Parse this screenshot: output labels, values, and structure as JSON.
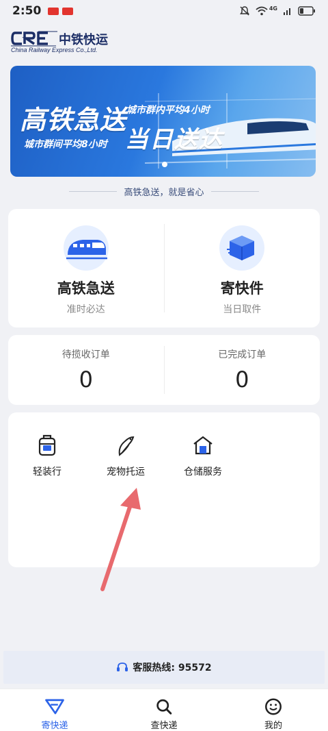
{
  "status_bar": {
    "time": "2:50",
    "network": "4G"
  },
  "logo": {
    "cn": "中铁快运",
    "en": "China Railway Express Co.,Ltd."
  },
  "banner": {
    "headline_left": "高铁急送",
    "headline_right": "当日送达",
    "sub_top": "城市群内平均4小时",
    "sub_bottom": "城市群间平均8小时"
  },
  "slogan": "高铁急送，就是省心",
  "services": [
    {
      "title": "高铁急送",
      "subtitle": "准时必达",
      "icon": "train-icon"
    },
    {
      "title": "寄快件",
      "subtitle": "当日取件",
      "icon": "package-icon"
    }
  ],
  "orders": [
    {
      "label": "待揽收订单",
      "count": "0"
    },
    {
      "label": "已完成订单",
      "count": "0"
    }
  ],
  "tools": [
    {
      "label": "轻装行",
      "icon": "backpack-icon"
    },
    {
      "label": "宠物托运",
      "icon": "bird-icon"
    },
    {
      "label": "仓储服务",
      "icon": "warehouse-icon"
    }
  ],
  "hotline": {
    "text": "客服热线: 95572"
  },
  "tabs": [
    {
      "label": "寄快递",
      "icon": "send-icon",
      "active": true
    },
    {
      "label": "查快递",
      "icon": "search-icon",
      "active": false
    },
    {
      "label": "我的",
      "icon": "smile-icon",
      "active": false
    }
  ],
  "colors": {
    "accent": "#2c63e8",
    "brand_navy": "#1c2e66",
    "annotation_arrow": "#e86a6e",
    "background": "#f0f1f5"
  }
}
